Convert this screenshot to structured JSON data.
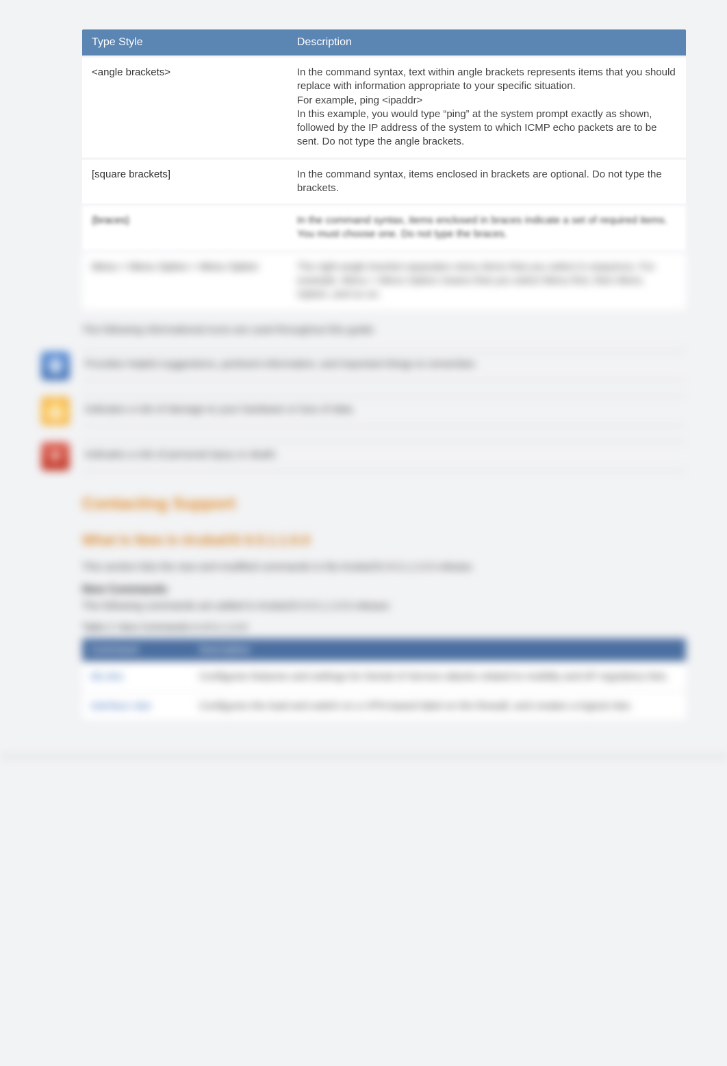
{
  "syntax_table": {
    "headers": [
      "Type Style",
      "Description"
    ],
    "rows": [
      {
        "style": "<angle brackets>",
        "desc": "In the command syntax, text within angle brackets represents items that you should replace with information appropriate to your specific situation.\nFor example, ping <ipaddr>\nIn this example, you would type “ping” at the system prompt exactly as shown, followed by the IP address of the system to which ICMP echo packets are to be sent. Do not type the angle brackets."
      },
      {
        "style": "[square brackets]",
        "desc": "In the command syntax, items enclosed in brackets are optional. Do not type the brackets."
      },
      {
        "style": "{braces}",
        "desc": "In the command syntax, items enclosed in braces indicate a set of required items. You must choose one. Do not type the braces."
      },
      {
        "style": "Menu > Menu Option > Menu Option",
        "desc": "The right-angle bracket separates menu items that you select in sequence. For example, Menu > Menu Option means that you select Menu first, then Menu Option, and so on."
      }
    ]
  },
  "intro_para": "The following informational icons are used throughout this guide:",
  "callouts": [
    {
      "kind": "note",
      "text": "Provides helpful suggestions, pertinent information, and important things to remember."
    },
    {
      "kind": "warn",
      "text": "Indicates a risk of damage to your hardware or loss of data."
    },
    {
      "kind": "danger",
      "text": "Indicates a risk of personal injury or death."
    }
  ],
  "section_heading": "Contacting Support",
  "whatsnew_heading": "What Is New in ArubaOS 6.5.1.1.0.0",
  "whatsnew_sub": "This section lists the new and modified commands in the ArubaOS 6.5.1.1.0.0 release.",
  "newcmds_heading": "New Commands",
  "newcmds_sub": "The following commands are added in ArubaOS 6.5.1.1.0.0 release:",
  "table_caption": "Table 2: New Commands in 6.5.1.1.0.0",
  "cmds_table": {
    "headers": [
      "Command",
      "Description"
    ],
    "rows": [
      {
        "cmd": "ids-dos",
        "desc": "Configures features and settings for Denial of Service attacks related to mobility and AP regulatory lists."
      },
      {
        "cmd": "interface vlan",
        "desc": "Configures the load and switch on a VPN-based label on the firewall, and creates a logical vlan."
      }
    ]
  }
}
